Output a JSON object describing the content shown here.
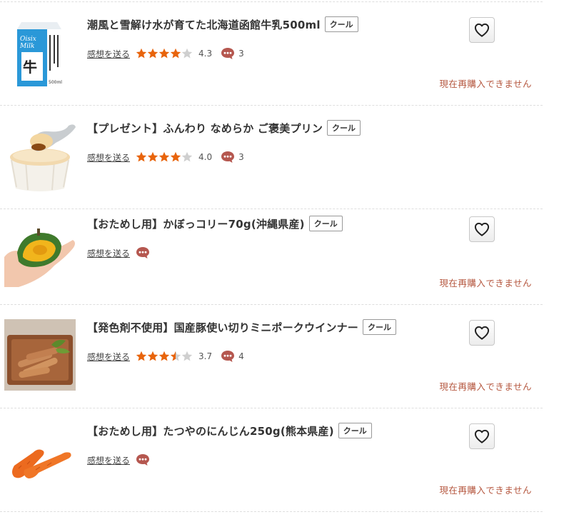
{
  "labels": {
    "review_link": "感想を送る",
    "unavailable": "現在再購入できません"
  },
  "colors": {
    "star_on": "#e8640c",
    "star_off": "#cfcfcf",
    "comment_icon": "#b5574f",
    "status_text": "#b5573f"
  },
  "items": [
    {
      "title": "潮風と雪解け水が育てた北海道函館牛乳500ml",
      "badge": "クール",
      "image_icon": "milk-carton-icon",
      "rating": 4.3,
      "rating_text": "4.3",
      "stars": [
        1,
        1,
        1,
        1,
        0
      ],
      "comments": "3",
      "has_rating": true,
      "status": "現在再購入できません"
    },
    {
      "title": "【プレゼント】ふんわり なめらか ご褒美プリン",
      "badge": "クール",
      "image_icon": "pudding-icon",
      "rating": 4.0,
      "rating_text": "4.0",
      "stars": [
        1,
        1,
        1,
        1,
        0
      ],
      "comments": "3",
      "has_rating": true,
      "status": ""
    },
    {
      "title": "【おためし用】かぼっコリー70g(沖縄県産)",
      "badge": "クール",
      "image_icon": "pumpkin-icon",
      "has_rating": false,
      "comments": "",
      "status": "現在再購入できません"
    },
    {
      "title": "【発色剤不使用】国産豚使い切りミニポークウインナー",
      "badge": "クール",
      "image_icon": "sausage-icon",
      "rating": 3.7,
      "rating_text": "3.7",
      "stars": [
        1,
        1,
        1,
        0.5,
        0
      ],
      "comments": "4",
      "has_rating": true,
      "status": "現在再購入できません"
    },
    {
      "title": "【おためし用】たつやのにんじん250g(熊本県産)",
      "badge": "クール",
      "image_icon": "carrot-icon",
      "has_rating": false,
      "comments": "",
      "status": "現在再購入できません"
    }
  ]
}
